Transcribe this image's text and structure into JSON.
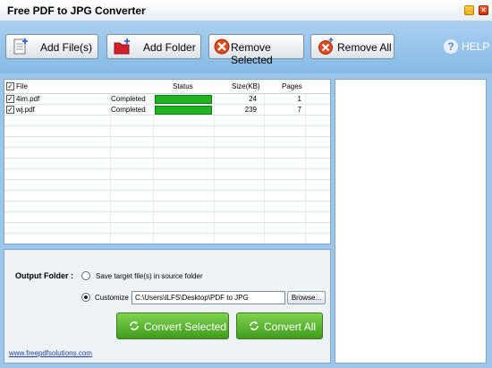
{
  "window": {
    "title": "Free PDF to JPG Converter"
  },
  "toolbar": {
    "add_files": "Add File(s)",
    "add_folder": "Add Folder",
    "remove_selected": "Remove Selected",
    "remove_all": "Remove All",
    "help": "HELP"
  },
  "table": {
    "columns": {
      "file": "File",
      "status": "Status",
      "size": "Size(KB)",
      "pages": "Pages"
    },
    "rows": [
      {
        "name": "4im.pdf",
        "status": "Completed",
        "progress": 1.0,
        "size": "24",
        "pages": "1",
        "checked": true
      },
      {
        "name": "wj.pdf",
        "status": "Completed",
        "progress": 1.0,
        "size": "239",
        "pages": "7",
        "checked": true
      }
    ]
  },
  "output": {
    "label": "Output Folder :",
    "option_source": "Save target file(s) in source folder",
    "option_custom": "Customize :",
    "selected": "customize",
    "path": "C:\\Users\\ILFS\\Desktop\\PDF to JPG",
    "browse": "Browse...",
    "convert_selected": "Convert Selected",
    "convert_all": "Convert All",
    "website": "www.freepdfsolutions.com"
  },
  "colors": {
    "accent": "#86b9e4",
    "progress": "#1fb31f",
    "convert": "#4fae28"
  }
}
